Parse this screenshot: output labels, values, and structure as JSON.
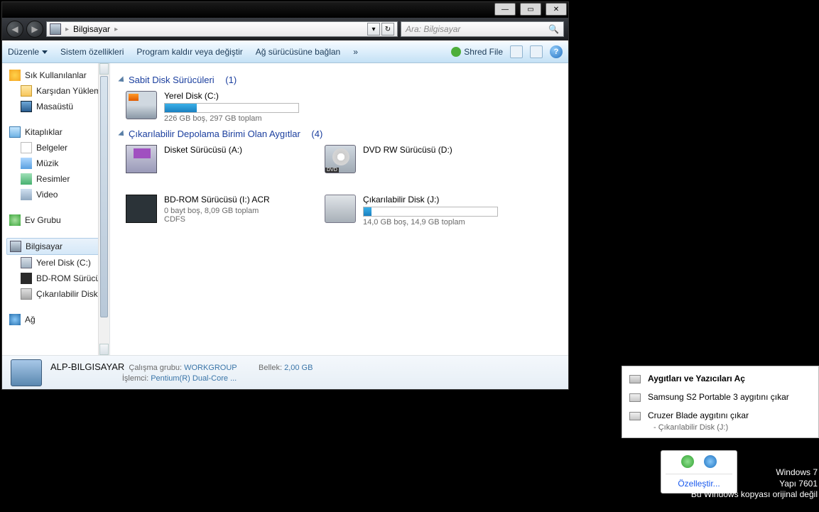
{
  "titlebar": {
    "min": "—",
    "max": "▭",
    "close": "✕"
  },
  "nav": {
    "back": "◀",
    "fwd": "▶"
  },
  "address": {
    "icon": "computer-icon",
    "path": "Bilgisayar",
    "dropdown": "▾",
    "refresh": "↻"
  },
  "search": {
    "placeholder": "Ara: Bilgisayar",
    "icon": "🔍"
  },
  "toolbar": {
    "organize": "Düzenle",
    "sysprop": "Sistem özellikleri",
    "uninstall": "Program kaldır veya değiştir",
    "mapdrive": "Ağ sürücüsüne bağlan",
    "overflow": "»",
    "shred": "Shred File"
  },
  "sidebar": {
    "fav": {
      "head": "Sık Kullanılanlar",
      "items": [
        "Karşıdan Yüklemeler",
        "Masaüstü"
      ]
    },
    "lib": {
      "head": "Kitaplıklar",
      "items": [
        "Belgeler",
        "Müzik",
        "Resimler",
        "Video"
      ]
    },
    "home": {
      "head": "Ev Grubu"
    },
    "comp": {
      "head": "Bilgisayar",
      "items": [
        "Yerel Disk (C:)",
        "BD-ROM Sürücüsü (I:) ACR",
        "Çıkarılabilir Disk (J:)"
      ]
    },
    "net": {
      "head": "Ağ"
    }
  },
  "groups": [
    {
      "title": "Sabit Disk Sürücüleri",
      "count": "(1)",
      "drives": [
        {
          "name": "Yerel Disk (C:)",
          "bar": 24,
          "sub": "226 GB boş, 297 GB toplam",
          "icon": "hdd"
        }
      ]
    },
    {
      "title": "Çıkarılabilir Depolama Birimi Olan Aygıtlar",
      "count": "(4)",
      "drives": [
        {
          "name": "Disket Sürücüsü (A:)",
          "icon": "floppy"
        },
        {
          "name": "DVD RW Sürücüsü (D:)",
          "icon": "dvd"
        },
        {
          "name": "BD-ROM Sürücüsü (I:) ACR",
          "sub": "0 bayt boş, 8,09 GB toplam",
          "sub2": "CDFS",
          "icon": "bd"
        },
        {
          "name": "Çıkarılabilir Disk (J:)",
          "bar": 6,
          "sub": "14,0 GB boş, 14,9 GB toplam",
          "icon": "rem"
        }
      ]
    }
  ],
  "status": {
    "name": "ALP-BILGISAYAR",
    "wglabel": "Çalışma grubu:",
    "wg": "WORKGROUP",
    "memlabel": "Bellek:",
    "mem": "2,00 GB",
    "cpulabel": "İşlemci:",
    "cpu": "Pentium(R) Dual-Core  ..."
  },
  "eject": {
    "open": "Aygıtları ve Yazıcıları Aç",
    "dev1": "Samsung S2 Portable 3 aygıtını çıkar",
    "dev2": "Cruzer Blade aygıtını çıkar",
    "dev2sub": "-   Çıkarılabilir Disk (J:)"
  },
  "tray": {
    "link": "Özelleştir..."
  },
  "desk": {
    "l1": "Windows 7",
    "l2": "Yapı 7601",
    "l3": "Bu Windows kopyası orijinal değil"
  }
}
